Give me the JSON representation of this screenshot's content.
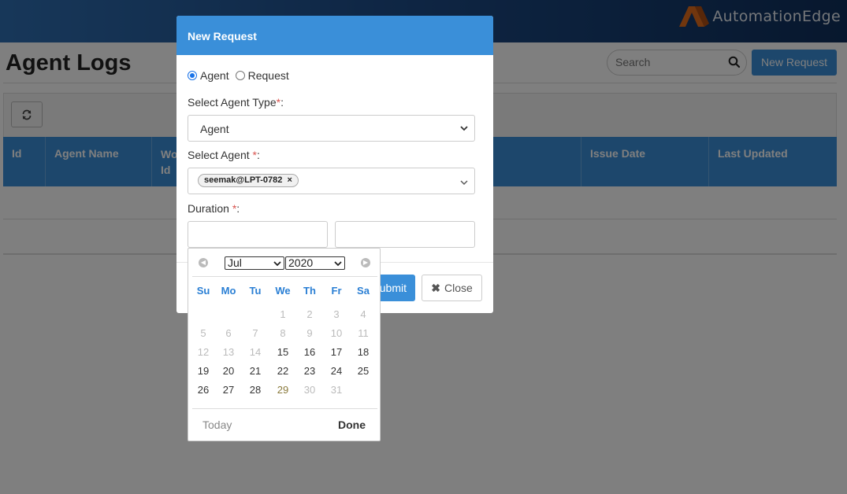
{
  "brand": {
    "name": "AutomationEdge"
  },
  "page": {
    "title": "Agent Logs"
  },
  "search": {
    "placeholder": "Search"
  },
  "toolbar": {
    "new_request_label": "New Request"
  },
  "table": {
    "columns": [
      "Id",
      "Agent Name",
      "Wo Id",
      "",
      "",
      "Issue Date",
      "Last Updated"
    ]
  },
  "modal": {
    "title": "New Request",
    "radio_agent_label": "Agent",
    "radio_request_label": "Request",
    "agent_type_label": "Select Agent Type",
    "agent_type_value": "Agent",
    "agent_label": "Select Agent ",
    "agent_tag": "seemak@LPT-0782",
    "duration_label": "Duration ",
    "required_mark": "*",
    "colon": ":",
    "submit_label": "Submit",
    "close_label": "Close"
  },
  "datepicker": {
    "month": "Jul",
    "year": "2020",
    "weekdays": [
      "Su",
      "Mo",
      "Tu",
      "We",
      "Th",
      "Fr",
      "Sa"
    ],
    "days": [
      [
        "",
        "",
        "",
        "1",
        "2",
        "3",
        "4"
      ],
      [
        "5",
        "6",
        "7",
        "8",
        "9",
        "10",
        "11"
      ],
      [
        "12",
        "13",
        "14",
        "15",
        "16",
        "17",
        "18"
      ],
      [
        "19",
        "20",
        "21",
        "22",
        "23",
        "24",
        "25"
      ],
      [
        "26",
        "27",
        "28",
        "29",
        "30",
        "31",
        ""
      ]
    ],
    "enabled_days": [
      "15",
      "16",
      "17",
      "18",
      "19",
      "20",
      "21",
      "22",
      "23",
      "24",
      "25",
      "26",
      "27",
      "28",
      "29"
    ],
    "today_day": "29",
    "today_label": "Today",
    "done_label": "Done"
  },
  "colors": {
    "accent": "#3a8fd9",
    "weekday": "#2a7fd4",
    "required": "#d9534f"
  }
}
